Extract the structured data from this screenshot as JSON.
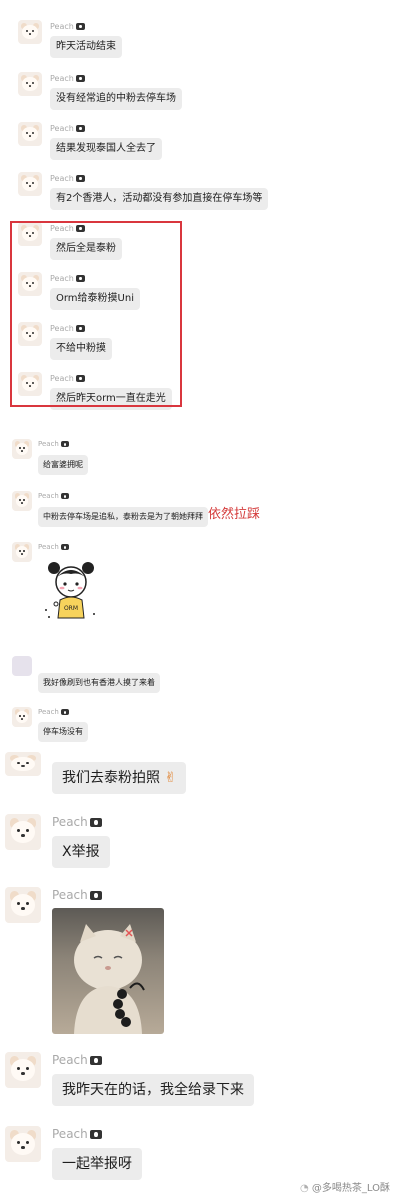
{
  "section1": {
    "messages": [
      {
        "name": "Peach",
        "text": "昨天活动结束"
      },
      {
        "name": "Peach",
        "text": "没有经常追的中粉去停车场"
      },
      {
        "name": "Peach",
        "text": "结果发现泰国人全去了"
      },
      {
        "name": "Peach",
        "text": "有2个香港人，活动都没有参加直接在停车场等"
      },
      {
        "name": "Peach",
        "text": "然后全是泰粉"
      },
      {
        "name": "Peach",
        "text": "Orm给泰粉摸Uni"
      },
      {
        "name": "Peach",
        "text": "不给中粉摸"
      },
      {
        "name": "Peach",
        "text": "然后昨天orm一直在走光"
      }
    ]
  },
  "section2": {
    "messages": [
      {
        "name": "Peach",
        "text": "给富婆拥呢"
      },
      {
        "name": "Peach",
        "text": "中粉去停车场是追私，泰粉去是为了朝她拜拜"
      },
      {
        "name": "Peach",
        "text": ""
      },
      {
        "name": "",
        "text": "我好像刷到也有香港人摸了来着"
      },
      {
        "name": "Peach",
        "text": "停车场没有"
      }
    ],
    "annotation": "依然拉踩",
    "sticker_text": "ORM"
  },
  "section3": {
    "messages": [
      {
        "name": "",
        "text": "我们去泰粉拍照"
      },
      {
        "name": "Peach",
        "text": "X举报"
      },
      {
        "name": "Peach",
        "text": ""
      },
      {
        "name": "Peach",
        "text": "我昨天在的话，我全给录下来"
      },
      {
        "name": "Peach",
        "text": "一起举报呀"
      }
    ]
  },
  "watermark": "@多喝热茶_LO酥",
  "colors": {
    "bubble": "#ececec",
    "highlight_box": "#d9363e",
    "annotation": "#d43b3b"
  }
}
